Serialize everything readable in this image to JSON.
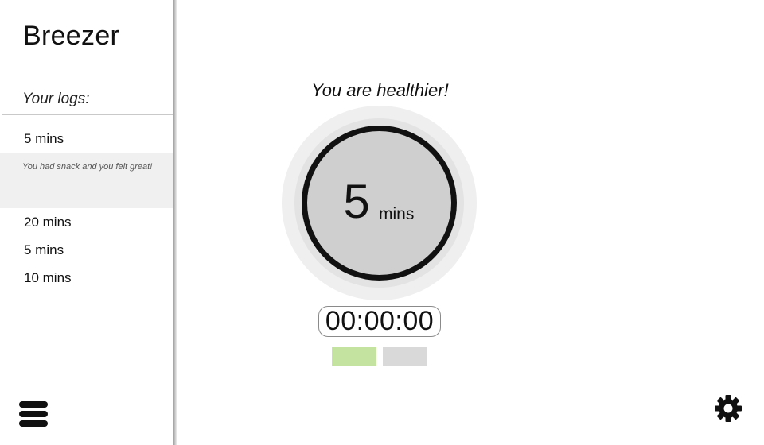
{
  "app": {
    "title": "Breezer"
  },
  "sidebar": {
    "logs_heading": "Your logs:",
    "logs": [
      {
        "duration": "5 mins",
        "note": "You had snack and you felt great!",
        "expanded": true
      },
      {
        "duration": "20 mins"
      },
      {
        "duration": "5 mins"
      },
      {
        "duration": "10 mins"
      }
    ],
    "menu_icon": "hamburger-menu-icon"
  },
  "main": {
    "message": "You are healthier!",
    "timer": {
      "value": "5",
      "unit": "mins"
    },
    "clock": "00:00:00",
    "start_color": "#c5e3a0",
    "stop_color": "#d9d9d9",
    "settings_icon": "gear-icon"
  }
}
